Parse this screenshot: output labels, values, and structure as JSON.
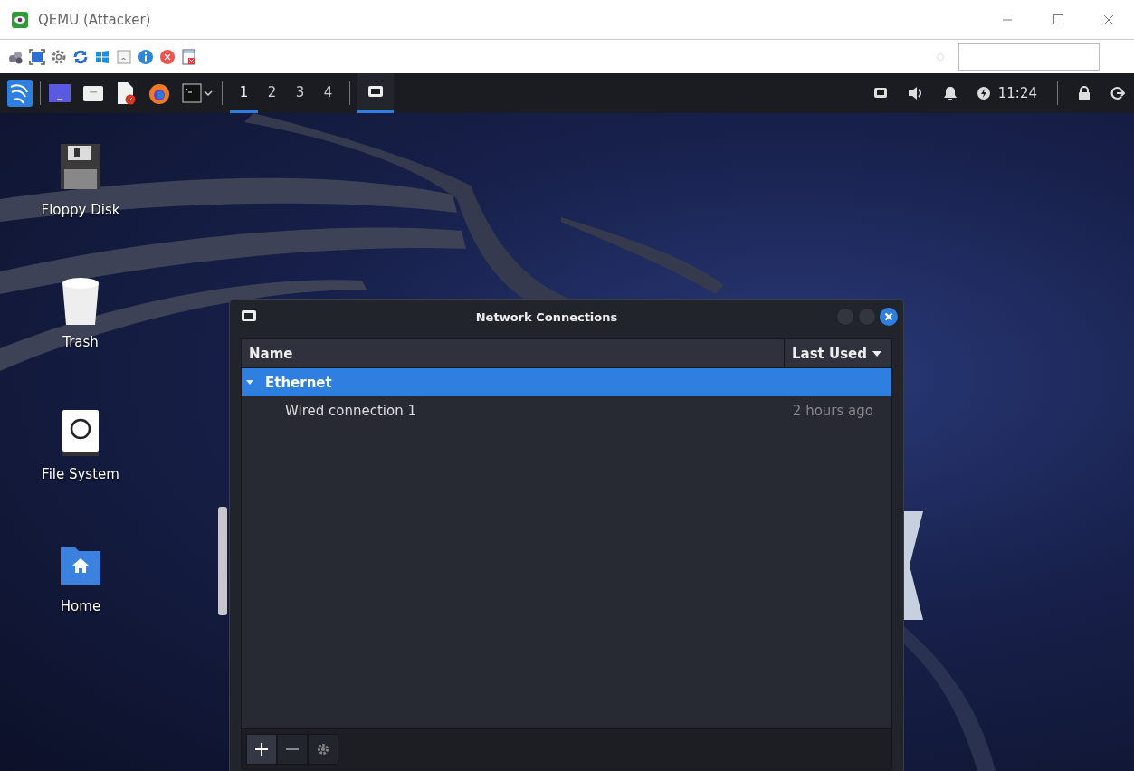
{
  "window": {
    "title": "QEMU (Attacker)"
  },
  "panel": {
    "workspaces": [
      {
        "label": "1",
        "selected": true
      },
      {
        "label": "2",
        "selected": false
      },
      {
        "label": "3",
        "selected": false
      },
      {
        "label": "4",
        "selected": false
      }
    ],
    "window_button": {
      "selected": true
    },
    "clock": "11:24"
  },
  "desktop_icons": [
    {
      "label": "Floppy Disk",
      "kind": "floppy"
    },
    {
      "label": "Trash",
      "kind": "trash"
    },
    {
      "label": "File System",
      "kind": "drive"
    },
    {
      "label": "Home",
      "kind": "home"
    }
  ],
  "dialog": {
    "title": "Network Connections",
    "columns": [
      {
        "label": "Name",
        "sorted": false
      },
      {
        "label": "Last Used",
        "sorted": true
      }
    ],
    "groups": [
      {
        "name": "Ethernet",
        "expanded": true,
        "selected": true,
        "children": [
          {
            "name": "Wired connection 1",
            "last_used": "2 hours ago",
            "selected": false
          }
        ]
      }
    ]
  }
}
